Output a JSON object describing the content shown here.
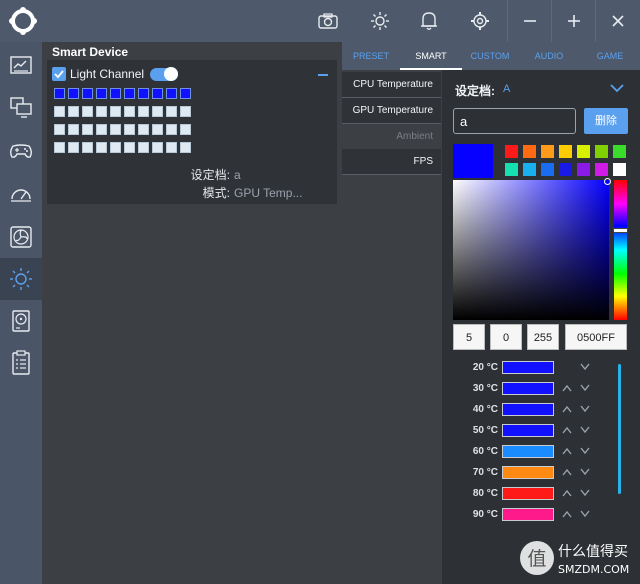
{
  "device": {
    "title": "Smart Device",
    "channel_label": "Light Channel",
    "channel_checked": true,
    "channel_enabled": true,
    "led_grid": {
      "rows": [
        [
          "blue",
          "blue",
          "blue",
          "blue",
          "blue",
          "blue",
          "blue",
          "blue",
          "blue",
          "blue"
        ],
        [
          "white",
          "white",
          "white",
          "white",
          "white",
          "white",
          "white",
          "white",
          "white",
          "white"
        ],
        [
          "white",
          "white",
          "white",
          "white",
          "white",
          "white",
          "white",
          "white",
          "white",
          "white"
        ],
        [
          "white",
          "white",
          "white",
          "white",
          "white",
          "white",
          "white",
          "white",
          "white",
          "white"
        ]
      ]
    },
    "profile_label": "设定档:",
    "profile_value": "a",
    "mode_label": "模式:",
    "mode_value": "GPU Temp..."
  },
  "tabs": [
    {
      "label": "PRESET",
      "active": false
    },
    {
      "label": "SMART",
      "active": true
    },
    {
      "label": "CUSTOM",
      "active": false
    },
    {
      "label": "AUDIO",
      "active": false
    },
    {
      "label": "GAME",
      "active": false
    }
  ],
  "modes": [
    {
      "label": "CPU Temperature",
      "state": "bright"
    },
    {
      "label": "GPU Temperature",
      "state": "bright"
    },
    {
      "label": "Ambient",
      "state": "dim"
    },
    {
      "label": "FPS",
      "state": "bright"
    }
  ],
  "settings": {
    "label": "设定档:",
    "value": "A",
    "name_input_value": "a",
    "delete_label": "删除",
    "current_color": "#0500FF",
    "swatches_row1": [
      "#ff1a1a",
      "#ff6a13",
      "#ff9a1a",
      "#ffcc00",
      "#d8f000",
      "#80d000",
      "#3adc2a"
    ],
    "swatches_row2": [
      "#16e0b0",
      "#1ab0f0",
      "#1a6cf0",
      "#1a1ae6",
      "#8a1ae6",
      "#d01ae6",
      "#ffffff"
    ],
    "r": "5",
    "g": "0",
    "b": "255",
    "hex": "0500FF"
  },
  "temps": [
    {
      "label": "20 °C",
      "color": "#1111ff",
      "arrows": false
    },
    {
      "label": "30 °C",
      "color": "#1111ff",
      "arrows": true
    },
    {
      "label": "40 °C",
      "color": "#1111ff",
      "arrows": true
    },
    {
      "label": "50 °C",
      "color": "#1111ff",
      "arrows": true
    },
    {
      "label": "60 °C",
      "color": "#1a8cff",
      "arrows": true
    },
    {
      "label": "70 °C",
      "color": "#ff8a13",
      "arrows": true
    },
    {
      "label": "80 °C",
      "color": "#ff1a1a",
      "arrows": true
    },
    {
      "label": "90 °C",
      "color": "#ff1a8c",
      "arrows": true
    }
  ],
  "watermark": {
    "logo_char": "值",
    "line1": "什么值得买",
    "line2": "SMZDM.COM"
  },
  "icons": {
    "logo": "app-logo-icon",
    "toolbar": [
      "camera-icon",
      "brightness-icon",
      "bell-icon",
      "gear-icon"
    ],
    "window": [
      "minimize-icon",
      "maximize-icon",
      "close-icon"
    ],
    "nav": [
      "dashboard-icon",
      "monitor-icon",
      "gamepad-icon",
      "speedometer-icon",
      "fan-icon",
      "lighting-icon",
      "storage-icon",
      "checklist-icon"
    ]
  }
}
